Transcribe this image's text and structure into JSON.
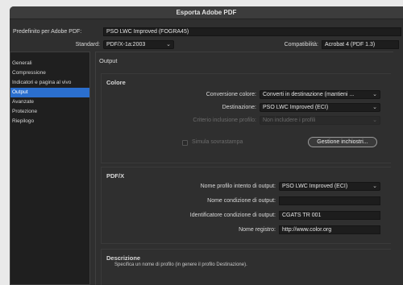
{
  "window": {
    "title": "Esporta Adobe PDF"
  },
  "preset": {
    "label": "Predefinito per Adobe PDF:",
    "value": "PSO LWC Improved (FOGRA45)"
  },
  "standard": {
    "label": "Standard:",
    "value": "PDF/X-1a:2003"
  },
  "compat": {
    "label": "Compatibilità:",
    "value": "Acrobat 4 (PDF 1.3)"
  },
  "sidebar": {
    "items": [
      {
        "label": "Generali"
      },
      {
        "label": "Compressione"
      },
      {
        "label": "Indicatori e pagina al vivo"
      },
      {
        "label": "Output"
      },
      {
        "label": "Avanzate"
      },
      {
        "label": "Protezione"
      },
      {
        "label": "Riepilogo"
      }
    ]
  },
  "output": {
    "heading": "Output",
    "color": {
      "heading": "Colore",
      "conversion": {
        "label": "Conversione colore:",
        "value": "Converti in destinazione (mantieni ..."
      },
      "destination": {
        "label": "Destinazione:",
        "value": "PSO LWC Improved (ECI)"
      },
      "profile_policy": {
        "label": "Criterio inclusione profilo:",
        "value": "Non includere i profili"
      },
      "simulate": {
        "label": "Simula sovrastampa"
      },
      "ink_manager": {
        "label": "Gestione inchiostri..."
      }
    },
    "pdfx": {
      "heading": "PDF/X",
      "intent_profile": {
        "label": "Nome profilo intento di output:",
        "value": "PSO LWC Improved (ECI)"
      },
      "condition_name": {
        "label": "Nome condizione di output:",
        "value": ""
      },
      "condition_id": {
        "label": "Identificatore condizione di output:",
        "value": "CGATS TR 001"
      },
      "registry": {
        "label": "Nome registro:",
        "value": "http://www.color.org"
      }
    },
    "description": {
      "heading": "Descrizione",
      "text": "Specifica un nome di profilo (in genere il profilo Destinazione)."
    }
  },
  "colors": {
    "selection": "#2b6fce",
    "window_bg": "#2f2f2f",
    "field_bg": "#1d1d1d"
  }
}
